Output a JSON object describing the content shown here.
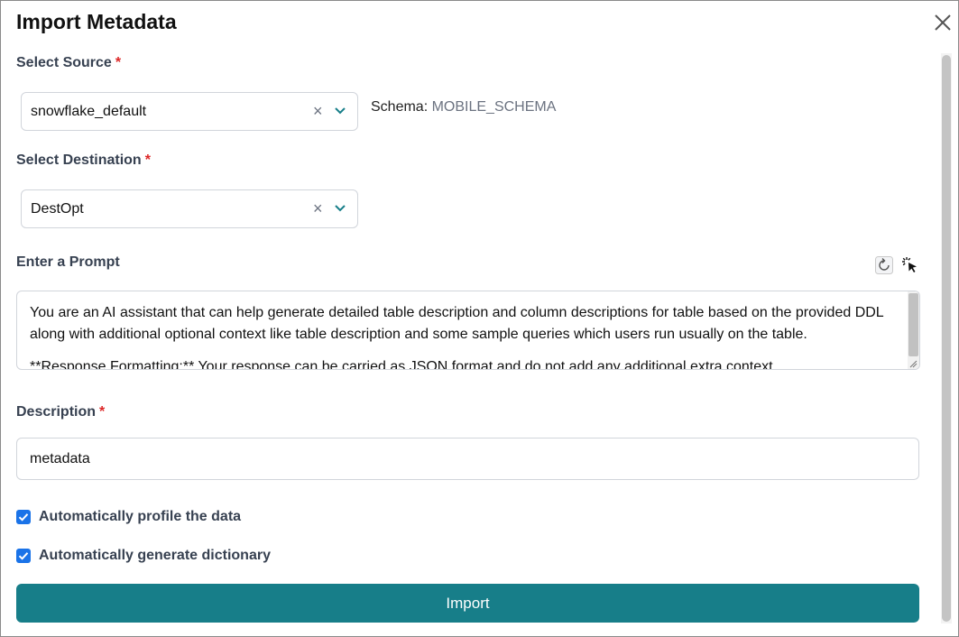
{
  "dialog": {
    "title": "Import Metadata"
  },
  "source": {
    "label": "Select Source",
    "required": "*",
    "value": "snowflake_default",
    "schema_label": "Schema:",
    "schema_value": "MOBILE_SCHEMA"
  },
  "destination": {
    "label": "Select Destination",
    "required": "*",
    "value": "DestOpt"
  },
  "prompt": {
    "label": "Enter a Prompt",
    "text_p1": "You are an AI assistant that can help generate detailed table description and column descriptions for table based on the provided DDL along with additional optional context like table description and some sample queries which users run usually on the table.",
    "text_p2": "**Response Formatting:** Your response can be carried as JSON format and do not add any additional extra context."
  },
  "description": {
    "label": "Description",
    "required": "*",
    "value": "metadata"
  },
  "options": {
    "profile_label": "Automatically profile the data",
    "profile_checked": true,
    "dictionary_label": "Automatically generate dictionary",
    "dictionary_checked": true
  },
  "actions": {
    "import_label": "Import"
  },
  "colors": {
    "primary": "#177e89",
    "checkbox": "#1a73e8",
    "required": "#dc2626"
  },
  "icons": [
    "close-icon",
    "clear-icon",
    "chevron-down-icon",
    "reset-icon",
    "magic-cursor-icon",
    "resize-handle-icon",
    "check-icon"
  ]
}
